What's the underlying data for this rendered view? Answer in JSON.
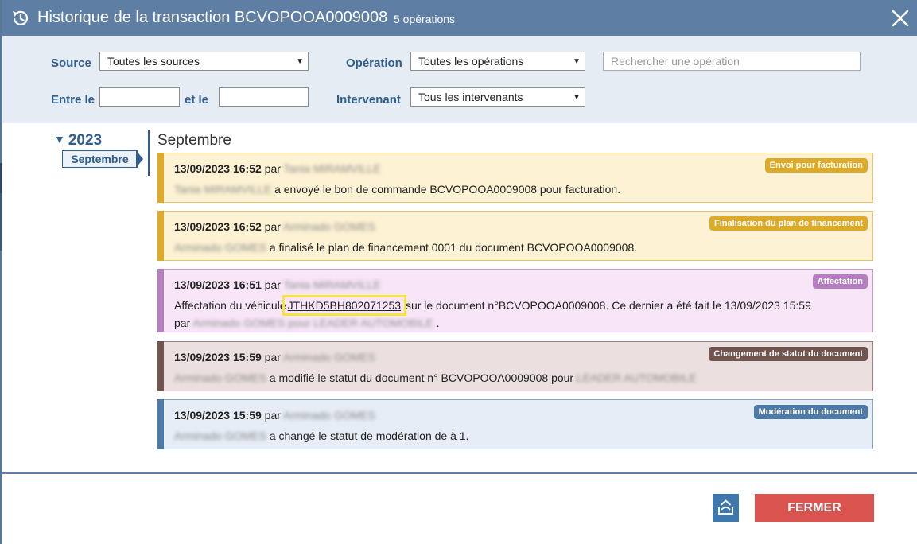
{
  "dialog": {
    "title": "Historique de la transaction BCVOPOOA0009008",
    "count": "5 opérations"
  },
  "filters": {
    "source_label": "Source",
    "source_value": "Toutes les sources",
    "operation_label": "Opération",
    "operation_value": "Toutes les opérations",
    "search_placeholder": "Rechercher une opération",
    "between_label": "Entre le",
    "and_label": "et le",
    "actor_label": "Intervenant",
    "actor_value": "Tous les intervenants"
  },
  "timeline": {
    "year": "2023",
    "month_tab": "Septembre",
    "month_title": "Septembre"
  },
  "entries": [
    {
      "datetime": "13/09/2023 16:52",
      "par": "par",
      "actor": "Tania MIRAMVILLE",
      "body_actor": "Tania MIRAMVILLE",
      "text": "a envoyé le bon de commande BCVOPOOA0009008 pour facturation.",
      "badge": "Envoi pour facturation",
      "colors": {
        "bg": "#fdf2d3",
        "border": "#e5c56a",
        "bar": "#deaa2a",
        "badge": "#deaa2a"
      }
    },
    {
      "datetime": "13/09/2023 16:52",
      "par": "par",
      "actor": "Arminado GOMES",
      "body_actor": "Arminado GOMES",
      "text": "a finalisé le plan de financement 0001 du document BCVOPOOA0009008.",
      "badge": "Finalisation du plan de financement",
      "colors": {
        "bg": "#fdf2d3",
        "border": "#e5c56a",
        "bar": "#deaa2a",
        "badge": "#deaa2a"
      }
    },
    {
      "datetime": "13/09/2023 16:51",
      "par": "par",
      "actor": "Tania MIRAMVILLE",
      "text_before": "Affectation du véhicule",
      "vin": "JTHKD5BH802071253",
      "text_after": "sur le document n°BCVOPOOA0009008. Ce dernier a été fait le 13/09/2023 15:59",
      "par2": "par",
      "body_actor2": "Arminado GOMES pour LEADER AUTOMOBILE",
      "end": ".",
      "badge": "Affectation",
      "colors": {
        "bg": "#f8e6f8",
        "border": "#c79bd0",
        "bar": "#b47ec0",
        "badge": "#b47ec0"
      }
    },
    {
      "datetime": "13/09/2023 15:59",
      "par": "par",
      "actor": "Arminado GOMES",
      "body_actor": "Arminado GOMES",
      "text": "a modifié le statut du document n° BCVOPOOA0009008 pour",
      "tail_blur": "LEADER AUTOMOBILE",
      "badge": "Changement de statut du document",
      "colors": {
        "bg": "#ebe0df",
        "border": "#9a7f7c",
        "bar": "#735550",
        "badge": "#735550"
      }
    },
    {
      "datetime": "13/09/2023 15:59",
      "par": "par",
      "actor": "Arminado GOMES",
      "body_actor": "Arminado GOMES",
      "text": "a changé le statut de modération de à 1.",
      "badge": "Modération du document",
      "colors": {
        "bg": "#e6edf6",
        "border": "#8aa6c6",
        "bar": "#4d7aa6",
        "badge": "#4d7aa6"
      }
    }
  ],
  "footer": {
    "close_label": "FERMER",
    "export_icon": "export-icon"
  }
}
